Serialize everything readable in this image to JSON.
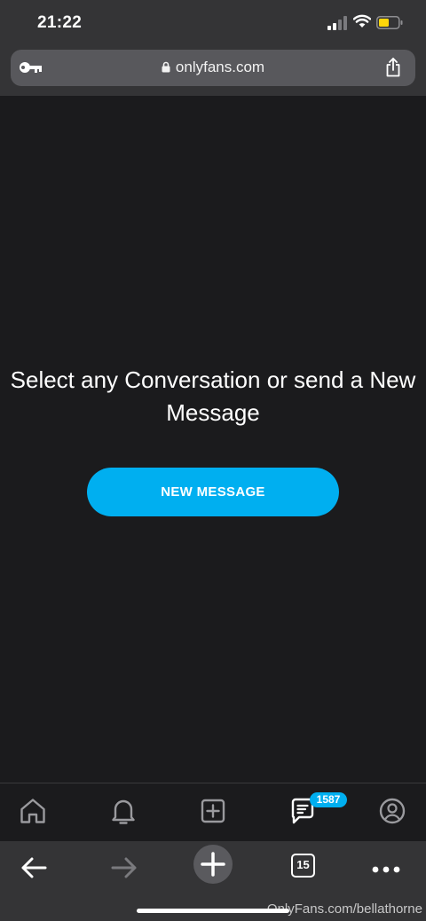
{
  "status_bar": {
    "time": "21:22"
  },
  "browser": {
    "url": "onlyfans.com"
  },
  "main": {
    "empty_state_text": "Select any Conversation or send a New Message",
    "new_message_label": "NEW MESSAGE"
  },
  "bottom_nav": {
    "items": [
      {
        "icon": "home-icon"
      },
      {
        "icon": "bell-icon"
      },
      {
        "icon": "add-post-icon"
      },
      {
        "icon": "messages-icon",
        "badge": "1587"
      },
      {
        "icon": "profile-icon"
      }
    ]
  },
  "safari_toolbar": {
    "items": [
      {
        "icon": "back-arrow-icon"
      },
      {
        "icon": "forward-arrow-icon"
      },
      {
        "icon": "new-tab-plus-icon"
      },
      {
        "icon": "tabs-icon",
        "count": "15"
      },
      {
        "icon": "more-icon"
      }
    ]
  },
  "watermark": "OnlyFans.com/bellathorne",
  "colors": {
    "accent": "#00aff0",
    "background": "#1b1b1d",
    "chrome": "#343436"
  }
}
